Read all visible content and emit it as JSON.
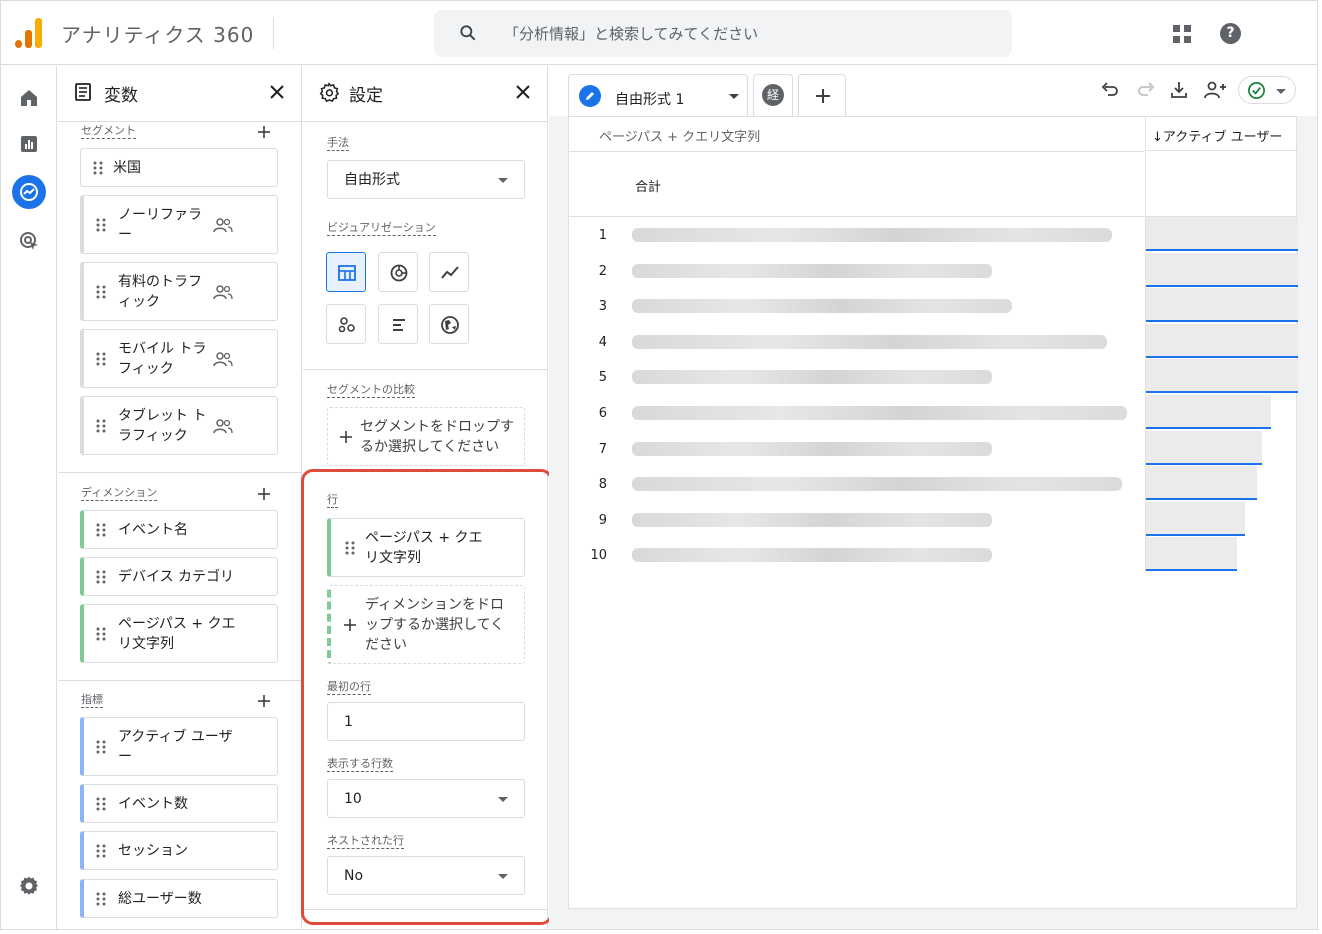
{
  "app": {
    "name": "アナリティクス 360"
  },
  "search": {
    "placeholder": "「分析情報」と検索してみてください"
  },
  "colors": {
    "accent": "#1a73e8",
    "highlight": "#e04b3c",
    "dimension": "#81c995",
    "metric": "#8ab4f8",
    "logo_orange": "#f9ab00",
    "logo_dark": "#e37400"
  },
  "nav": {
    "icons": [
      "home-icon",
      "reports-icon",
      "explore-icon",
      "advertising-icon",
      "settings-icon"
    ]
  },
  "variables": {
    "title": "変数",
    "segments_label": "セグメント",
    "segments": [
      "米国",
      "ノーリファラー",
      "有料のトラフィック",
      "モバイル トラフィック",
      "タブレット トラフィック"
    ],
    "dimensions_label": "ディメンション",
    "dimensions": [
      "イベント名",
      "デバイス カテゴリ",
      "ページパス + クエリ文字列"
    ],
    "metrics_label": "指標",
    "metrics": [
      "アクティブ ユーザー",
      "イベント数",
      "セッション",
      "総ユーザー数"
    ]
  },
  "settings": {
    "title": "設定",
    "technique_label": "手法",
    "technique_value": "自由形式",
    "viz_label": "ビジュアリゼーション",
    "viz_icons": [
      "table-icon",
      "donut-chart-icon",
      "line-chart-icon",
      "scatter-chart-icon",
      "bar-chart-icon",
      "geo-map-icon"
    ],
    "segment_compare_label": "セグメントの比較",
    "segment_drop": "セグメントをドロップするか選択してください",
    "rows_label": "行",
    "row_chip": "ページパス + クエリ文字列",
    "dimension_drop": "ディメンションをドロップするか選択してください",
    "first_row_label": "最初の行",
    "first_row_value": "1",
    "show_rows_label": "表示する行数",
    "show_rows_value": "10",
    "nested_rows_label": "ネストされた行",
    "nested_rows_value": "No"
  },
  "tabs": {
    "active": "自由形式 1",
    "second_icon_text": "経"
  },
  "table": {
    "dim_header": "ページパス + クエリ文字列",
    "metric_header": "アクティブ ユーザー",
    "total_label": "合計",
    "rows": [
      {
        "n": "1",
        "fill": 1.0
      },
      {
        "n": "2",
        "fill": 1.0
      },
      {
        "n": "3",
        "fill": 1.0
      },
      {
        "n": "4",
        "fill": 1.0
      },
      {
        "n": "5",
        "fill": 1.0
      },
      {
        "n": "6",
        "fill": 0.82
      },
      {
        "n": "7",
        "fill": 0.76
      },
      {
        "n": "8",
        "fill": 0.73
      },
      {
        "n": "9",
        "fill": 0.65
      },
      {
        "n": "10",
        "fill": 0.6
      }
    ]
  }
}
